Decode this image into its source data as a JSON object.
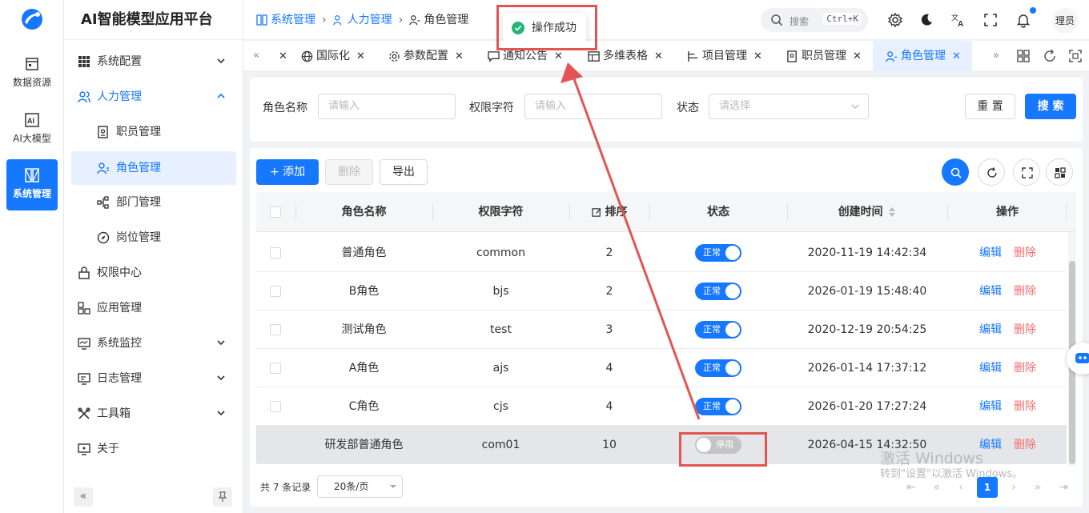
{
  "app": {
    "title": "AI智能模型应用平台",
    "accent": "#1677ff",
    "danger": "#f56c6c",
    "logo_icon": "brand-swirl-logo"
  },
  "rail": [
    {
      "label": "数据资源",
      "icon": "data-resource-icon"
    },
    {
      "label": "AI大模型",
      "icon": "ai-model-icon"
    },
    {
      "label": "系统管理",
      "icon": "system-manage-icon",
      "active": true
    }
  ],
  "menu": [
    {
      "label": "系统配置",
      "icon": "grid-icon",
      "chevron": "down"
    },
    {
      "label": "人力管理",
      "icon": "users-icon",
      "chevron": "up",
      "open": true
    },
    {
      "label": "职员管理",
      "icon": "employee-icon",
      "sub": true
    },
    {
      "label": "角色管理",
      "icon": "role-icon",
      "sub": true,
      "active": true
    },
    {
      "label": "部门管理",
      "icon": "department-icon",
      "sub": true
    },
    {
      "label": "岗位管理",
      "icon": "compass-icon",
      "sub": true
    },
    {
      "label": "权限中心",
      "icon": "lock-icon"
    },
    {
      "label": "应用管理",
      "icon": "apps-icon"
    },
    {
      "label": "系统监控",
      "icon": "monitor-icon",
      "chevron": "down"
    },
    {
      "label": "日志管理",
      "icon": "log-icon",
      "chevron": "down"
    },
    {
      "label": "工具箱",
      "icon": "tools-icon",
      "chevron": "down"
    },
    {
      "label": "关于",
      "icon": "about-icon"
    }
  ],
  "header": {
    "breadcrumb": [
      "系统管理",
      "人力管理",
      "角色管理"
    ],
    "search_label": "搜索",
    "search_shortcut": "Ctrl+K",
    "avatar_text": "理员"
  },
  "tabs": [
    {
      "label": "国际化",
      "icon": "globe-icon"
    },
    {
      "label": "参数配置",
      "icon": "settings-cog-icon"
    },
    {
      "label": "通知公告",
      "icon": "message-icon"
    },
    {
      "label": "多维表格",
      "icon": "table-icon"
    },
    {
      "label": "项目管理",
      "icon": "project-icon"
    },
    {
      "label": "职员管理",
      "icon": "employee-icon"
    },
    {
      "label": "角色管理",
      "icon": "role-icon",
      "active": true
    }
  ],
  "toast": {
    "text": "操作成功",
    "icon": "success-check-icon"
  },
  "filter": {
    "role_name_label": "角色名称",
    "role_name_placeholder": "请输入",
    "perm_label": "权限字符",
    "perm_placeholder": "请输入",
    "status_label": "状态",
    "status_placeholder": "请选择",
    "reset_label": "重 置",
    "search_label": "搜 索"
  },
  "toolbar": {
    "add_label": "+ 添加",
    "delete_label": "删除",
    "export_label": "导出"
  },
  "table": {
    "columns": [
      "角色名称",
      "权限字符",
      "排序",
      "状态",
      "创建时间",
      "操作"
    ],
    "edit_label": "编辑",
    "delete_label": "删除",
    "rows": [
      {
        "name": "普通角色",
        "key": "common",
        "sort": "2",
        "status": "正常",
        "on": true,
        "created": "2020-11-19 14:42:34"
      },
      {
        "name": "B角色",
        "key": "bjs",
        "sort": "2",
        "status": "正常",
        "on": true,
        "created": "2026-01-19 15:48:40"
      },
      {
        "name": "测试角色",
        "key": "test",
        "sort": "3",
        "status": "正常",
        "on": true,
        "created": "2020-12-19 20:54:25"
      },
      {
        "name": "A角色",
        "key": "ajs",
        "sort": "4",
        "status": "正常",
        "on": true,
        "created": "2026-01-14 17:37:12"
      },
      {
        "name": "C角色",
        "key": "cjs",
        "sort": "4",
        "status": "正常",
        "on": true,
        "created": "2026-01-20 17:27:24"
      },
      {
        "name": "研发部普通角色",
        "key": "com01",
        "sort": "10",
        "status": "停用",
        "on": false,
        "created": "2026-04-15 14:32:50",
        "highlight": true
      }
    ]
  },
  "pager": {
    "total": "共 7 条记录",
    "page_size": "20条/页",
    "current": "1"
  },
  "watermark": {
    "line1": "激活 Windows",
    "line2": "转到\"设置\"以激活 Windows。"
  }
}
